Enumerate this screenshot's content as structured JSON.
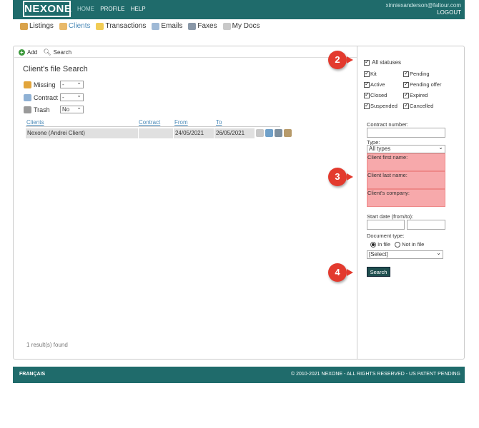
{
  "header": {
    "logo": "NEXONE",
    "nav": [
      "HOME",
      "PROFILE",
      "HELP"
    ],
    "user_email": "xinniexanderson@faltour.com",
    "logout": "LOGOUT"
  },
  "subnav": [
    {
      "label": "Listings",
      "icon": "home-icon"
    },
    {
      "label": "Clients",
      "icon": "clients-icon",
      "active": true
    },
    {
      "label": "Transactions",
      "icon": "folder-icon"
    },
    {
      "label": "Emails",
      "icon": "envelope-icon"
    },
    {
      "label": "Faxes",
      "icon": "fax-icon"
    },
    {
      "label": "My Docs",
      "icon": "docs-icon"
    }
  ],
  "toolbar": {
    "add": "Add",
    "search": "Search"
  },
  "page_title": "Client's file Search",
  "filters": [
    {
      "label": "Missing",
      "value": "-"
    },
    {
      "label": "Contract",
      "value": "-"
    },
    {
      "label": "Trash",
      "value": "No"
    }
  ],
  "table": {
    "headers": [
      "Clients",
      "Contract",
      "From",
      "To"
    ],
    "rows": [
      {
        "client": "Nexone (Andrei Client)",
        "contract": "",
        "from": "24/05/2021",
        "to": "26/05/2021"
      }
    ]
  },
  "results_text": "1 result(s) found",
  "statuses": {
    "all": "All statuses",
    "left": [
      "Kit",
      "Active",
      "Closed",
      "Suspended"
    ],
    "right": [
      "Pending",
      "Pending offer",
      "Expired",
      "Cancelled"
    ]
  },
  "form": {
    "contract_number": "Contract number:",
    "type_label": "Type:",
    "type_value": "All types",
    "client_first": "Client first name:",
    "client_last": "Client last name:",
    "client_company": "Client's company:",
    "start_date": "Start date (from/to):",
    "doc_type": "Document type:",
    "in_file": "In file",
    "not_in_file": "Not in file",
    "select_value": "[Select]",
    "search_button": "Search"
  },
  "badges": [
    "2",
    "3",
    "4"
  ],
  "footer": {
    "language": "FRANÇAIS",
    "copyright": "© 2010-2021 NEXONE - ALL RIGHTS RESERVED - US PATENT PENDING"
  },
  "colors": {
    "brand": "#1f6b6b",
    "highlight": "#f7a9ab",
    "badge": "#e33a2e",
    "link": "#4a89b7"
  }
}
